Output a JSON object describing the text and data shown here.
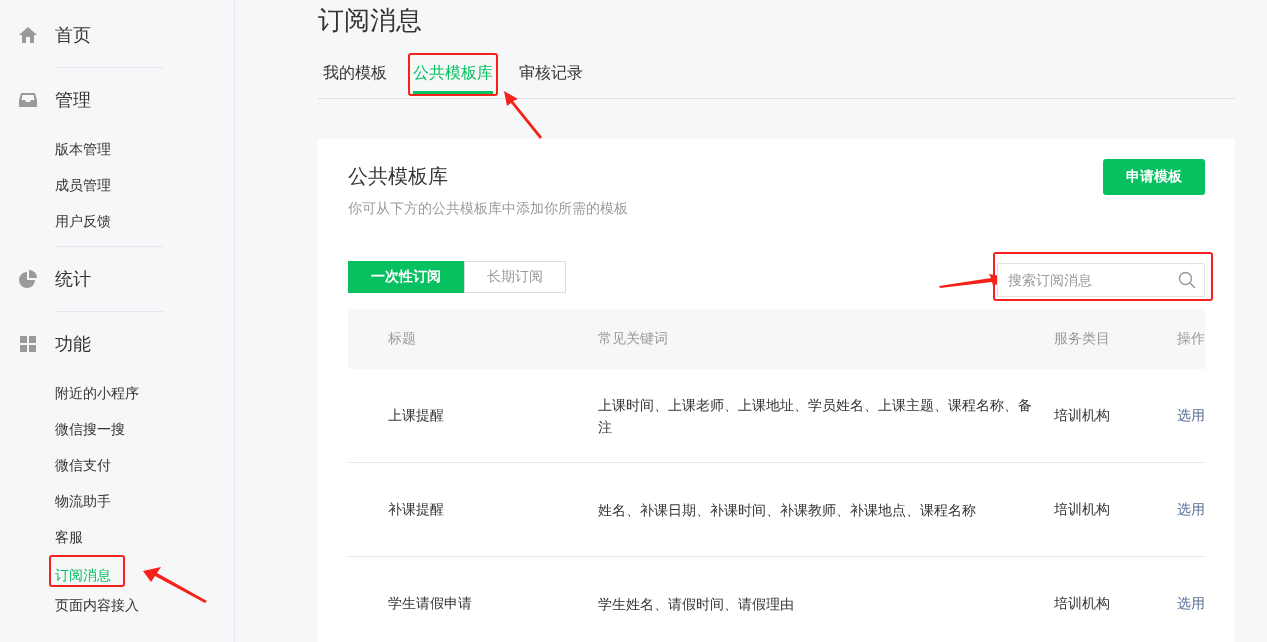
{
  "sidebar": {
    "groups": [
      {
        "label": "首页"
      },
      {
        "label": "管理",
        "items": [
          {
            "label": "版本管理",
            "selected": false,
            "highlighted": false
          },
          {
            "label": "成员管理",
            "selected": false,
            "highlighted": false
          },
          {
            "label": "用户反馈",
            "selected": false,
            "highlighted": false
          }
        ]
      },
      {
        "label": "统计"
      },
      {
        "label": "功能",
        "items": [
          {
            "label": "附近的小程序",
            "selected": false,
            "highlighted": false
          },
          {
            "label": "微信搜一搜",
            "selected": false,
            "highlighted": false
          },
          {
            "label": "微信支付",
            "selected": false,
            "highlighted": false
          },
          {
            "label": "物流助手",
            "selected": false,
            "highlighted": false
          },
          {
            "label": "客服",
            "selected": false,
            "highlighted": false
          },
          {
            "label": "订阅消息",
            "selected": true,
            "highlighted": true
          },
          {
            "label": "页面内容接入",
            "selected": false,
            "highlighted": false
          }
        ]
      }
    ]
  },
  "page_title": "订阅消息",
  "tabs": [
    {
      "label": "我的模板",
      "selected": false,
      "highlighted": false
    },
    {
      "label": "公共模板库",
      "selected": true,
      "highlighted": true
    },
    {
      "label": "审核记录",
      "selected": false,
      "highlighted": false
    }
  ],
  "card": {
    "title": "公共模板库",
    "subtitle": "你可从下方的公共模板库中添加你所需的模板",
    "apply_button": "申请模板",
    "segments": [
      {
        "label": "一次性订阅",
        "selected": true
      },
      {
        "label": "长期订阅",
        "selected": false
      }
    ],
    "search": {
      "placeholder": "搜索订阅消息",
      "highlighted": true
    },
    "table": {
      "columns": [
        "标题",
        "常见关键词",
        "服务类目",
        "操作"
      ],
      "rows": [
        {
          "title": "上课提醒",
          "keywords": "上课时间、上课老师、上课地址、学员姓名、上课主题、课程名称、备注",
          "category": "培训机构",
          "action": "选用"
        },
        {
          "title": "补课提醒",
          "keywords": "姓名、补课日期、补课时间、补课教师、补课地点、课程名称",
          "category": "培训机构",
          "action": "选用"
        },
        {
          "title": "学生请假申请",
          "keywords": "学生姓名、请假时间、请假理由",
          "category": "培训机构",
          "action": "选用"
        }
      ]
    }
  }
}
